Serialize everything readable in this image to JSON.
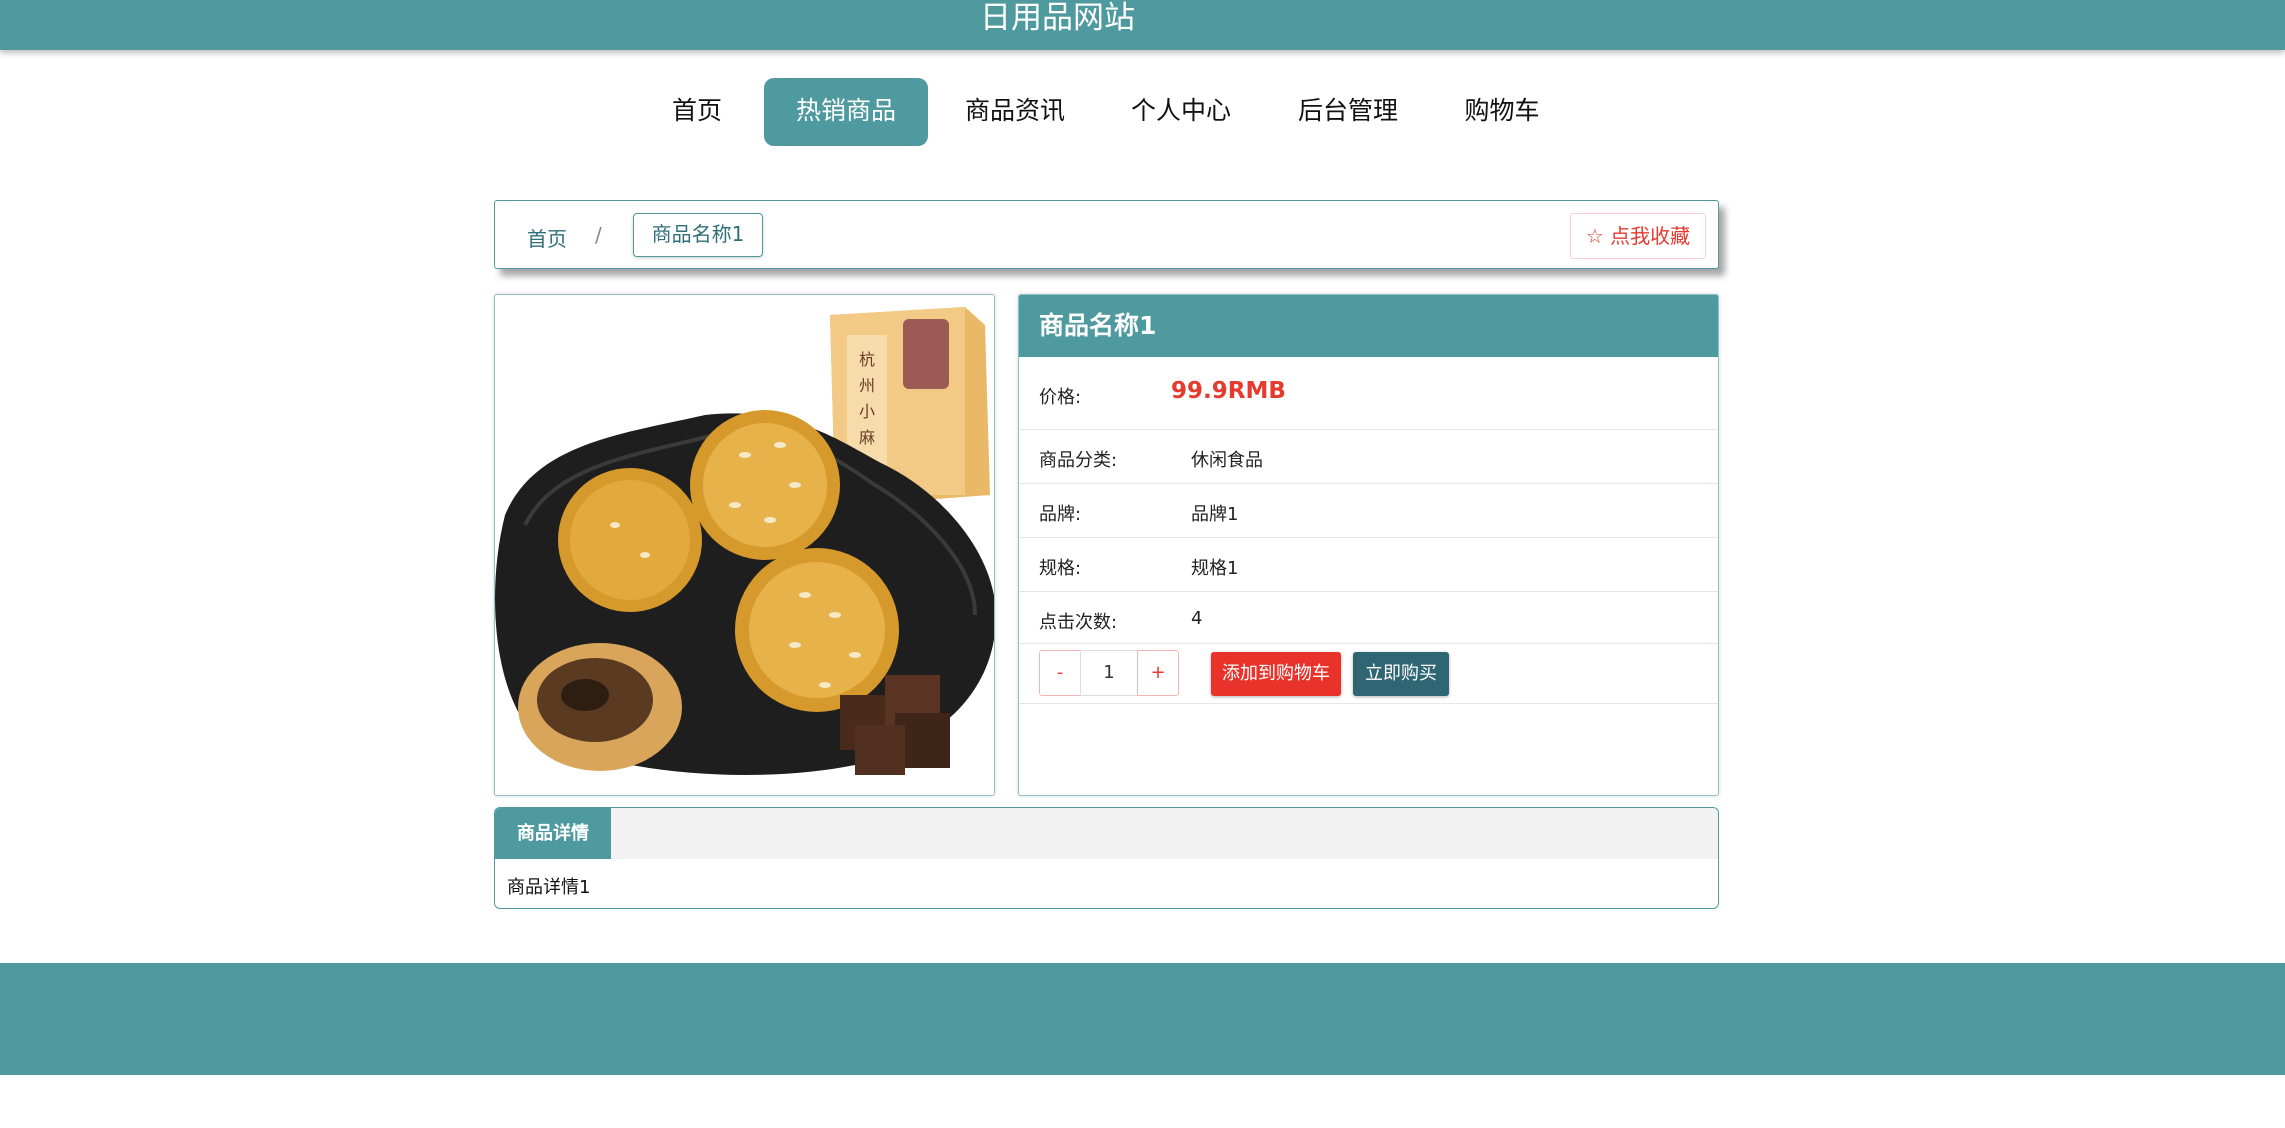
{
  "site": {
    "title": "日用品网站"
  },
  "nav": {
    "items": [
      {
        "label": "首页"
      },
      {
        "label": "热销商品",
        "active": true
      },
      {
        "label": "商品资讯"
      },
      {
        "label": "个人中心"
      },
      {
        "label": "后台管理"
      },
      {
        "label": "购物车"
      }
    ]
  },
  "breadcrumb": {
    "home": "首页",
    "separator": "/",
    "current": "商品名称1"
  },
  "favorite": {
    "label": "☆ 点我收藏"
  },
  "product": {
    "name": "商品名称1",
    "price_label": "价格:",
    "price": "99.9RMB",
    "category_label": "商品分类:",
    "category": "休闲食品",
    "brand_label": "品牌:",
    "brand": "品牌1",
    "spec_label": "规格:",
    "spec": "规格1",
    "clicks_label": "点击次数:",
    "clicks": "4"
  },
  "quantity": {
    "minus": "-",
    "value": "1",
    "plus": "+"
  },
  "actions": {
    "add_to_cart": "添加到购物车",
    "buy_now": "立即购买"
  },
  "detail": {
    "tab_label": "商品详情",
    "content": "商品详情1"
  },
  "colors": {
    "primary": "#4e9a9f",
    "accent_red": "#e8322a",
    "dark_teal": "#2f6673"
  }
}
